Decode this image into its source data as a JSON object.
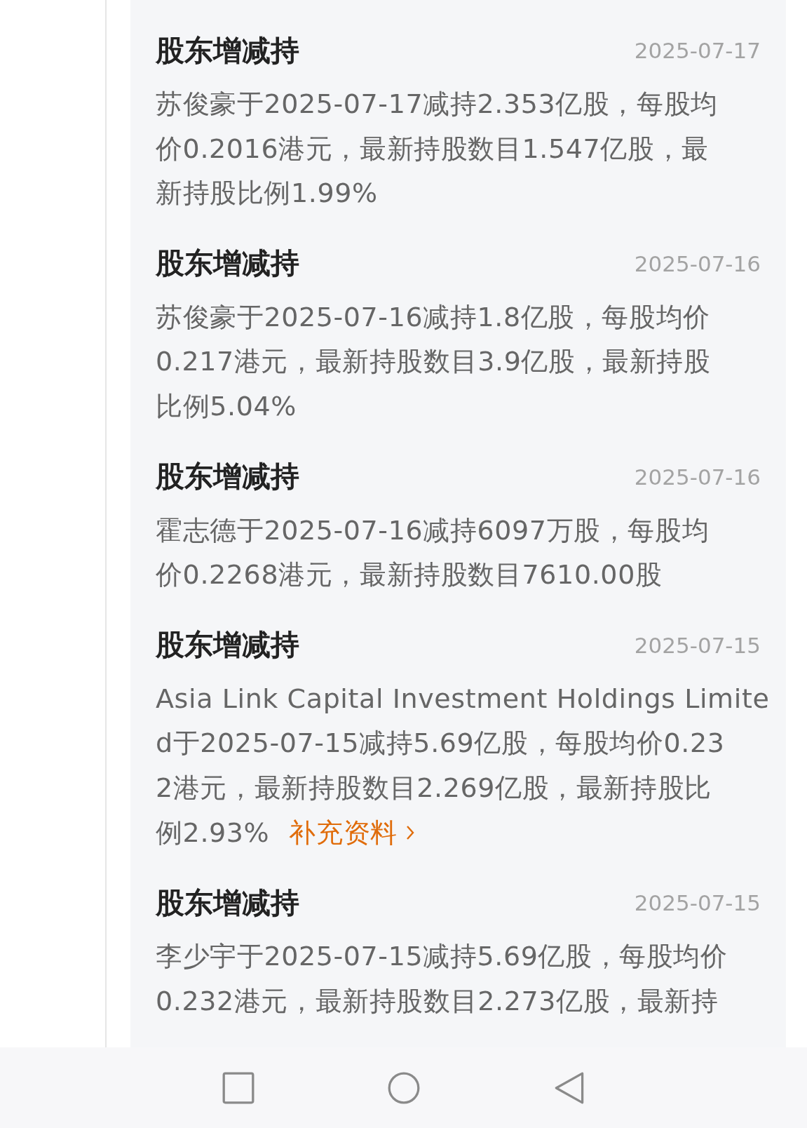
{
  "feed": [
    {
      "title": "股东增减持",
      "date": "2025-07-17",
      "lines": [
        "苏俊豪于2025-07-17减持2.353亿股，每股均",
        "价0.2016港元，最新持股数目1.547亿股，最",
        "新持股比例1.99%"
      ]
    },
    {
      "title": "股东增减持",
      "date": "2025-07-16",
      "lines": [
        "苏俊豪于2025-07-16减持1.8亿股，每股均价",
        "0.217港元，最新持股数目3.9亿股，最新持股",
        "比例5.04%"
      ]
    },
    {
      "title": "股东增减持",
      "date": "2025-07-16",
      "lines": [
        "霍志德于2025-07-16减持6097万股，每股均",
        "价0.2268港元，最新持股数目7610.00股"
      ]
    },
    {
      "title": "股东增减持",
      "date": "2025-07-15",
      "lines": [
        "Asia Link Capital Investment Holdings Limite",
        "d于2025-07-15减持5.69亿股，每股均价0.23",
        "2港元，最新持股数目2.269亿股，最新持股比",
        "例2.93%"
      ],
      "link": "补充资料"
    },
    {
      "title": "股东增减持",
      "date": "2025-07-15",
      "lines": [
        "李少宇于2025-07-15减持5.69亿股，每股均价",
        "0.232港元，最新持股数目2.273亿股，最新持"
      ]
    }
  ],
  "nav_bar": [
    {
      "kind": "square"
    },
    {
      "kind": "circle"
    },
    {
      "kind": "triangle"
    }
  ]
}
